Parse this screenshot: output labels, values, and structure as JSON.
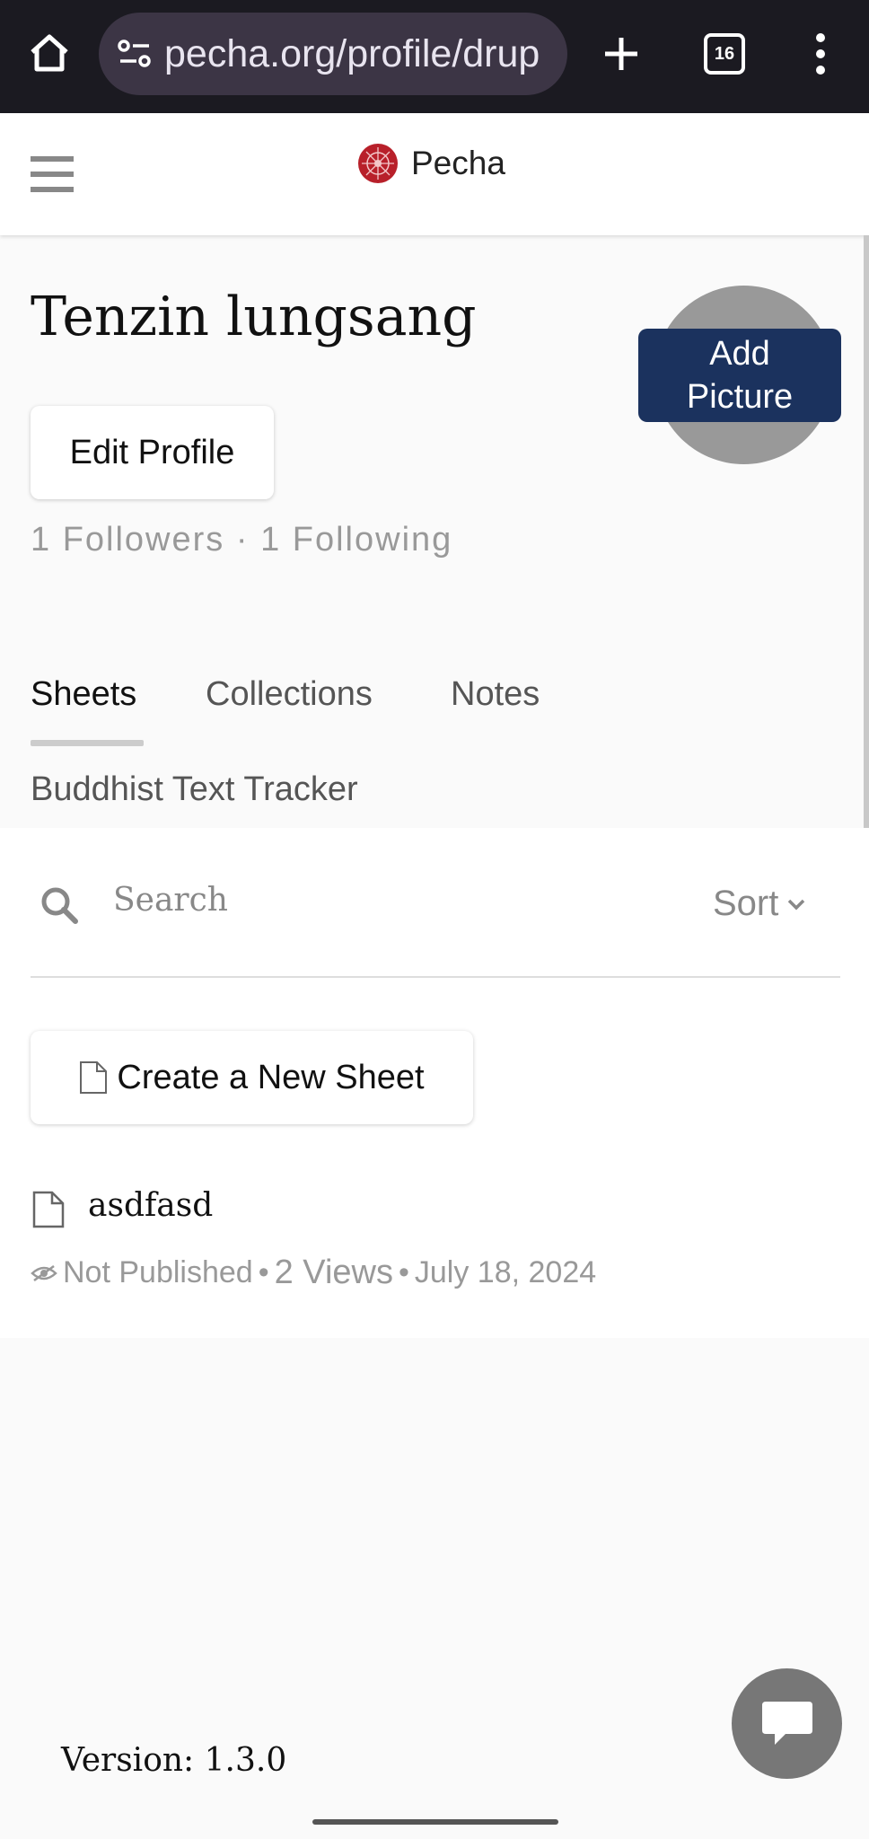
{
  "browser": {
    "url": "pecha.org/profile/drup",
    "tab_count": "16"
  },
  "site": {
    "brand": "Pecha"
  },
  "profile": {
    "name": "Tenzin lungsang",
    "edit_label": "Edit Profile",
    "followers": "1 Followers",
    "following": "1 Following",
    "add_picture_line1": "Add",
    "add_picture_line2": "Picture"
  },
  "tabs": [
    {
      "label": "Sheets",
      "active": true
    },
    {
      "label": "Collections",
      "active": false
    },
    {
      "label": "Notes",
      "active": false
    }
  ],
  "sublabel": "Buddhist Text Tracker",
  "search": {
    "placeholder": "Search",
    "sort_label": "Sort"
  },
  "create_sheet_label": "Create a New Sheet",
  "sheets": [
    {
      "title": "asdfasd",
      "status": "Not Published",
      "views": "2 Views",
      "date": "July 18, 2024"
    }
  ],
  "footer": {
    "version": "Version: 1.3.0"
  },
  "colors": {
    "accent_button": "#1b325e",
    "brand_red": "#b8202a"
  }
}
